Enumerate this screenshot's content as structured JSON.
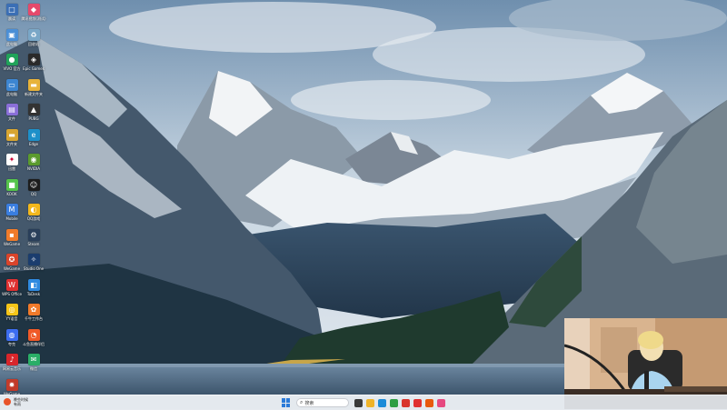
{
  "desktop": {
    "icons": [
      {
        "label": "晨读",
        "icon": "app-icon",
        "color": "#3b6fb5",
        "glyph": "□"
      },
      {
        "label": "腾讯视频(测试)",
        "icon": "app-icon",
        "color": "#e54a6b",
        "glyph": "◆"
      },
      {
        "label": "此电脑",
        "icon": "computer-icon",
        "color": "#4b8fd6",
        "glyph": "▣"
      },
      {
        "label": "回收站",
        "icon": "recycle-bin-icon",
        "color": "#7aa7c7",
        "glyph": "♻"
      },
      {
        "label": "VIVO 官方",
        "icon": "app-icon",
        "color": "#21a35a",
        "glyph": "●"
      },
      {
        "label": "Epic Games",
        "icon": "app-icon",
        "color": "#2a2a2a",
        "glyph": "◈"
      },
      {
        "label": "此电脑",
        "icon": "computer-icon",
        "color": "#3d86d1",
        "glyph": "▭"
      },
      {
        "label": "新建文件夹",
        "icon": "folder-icon",
        "color": "#e8b33a",
        "glyph": "▬"
      },
      {
        "label": "文件",
        "icon": "file-icon",
        "color": "#8a6fd8",
        "glyph": "▤"
      },
      {
        "label": "PUBG",
        "icon": "app-icon",
        "color": "#333333",
        "glyph": "▲"
      },
      {
        "label": "文件夹",
        "icon": "folder-icon",
        "color": "#d8a531",
        "glyph": "▬"
      },
      {
        "label": "Edge",
        "icon": "browser-icon",
        "color": "#1e90c9",
        "glyph": "e"
      },
      {
        "label": "迅雷",
        "icon": "app-icon",
        "color": "#ffffff",
        "glyph": "✦"
      },
      {
        "label": "NVIDIA",
        "icon": "app-icon",
        "color": "#5b9b2e",
        "glyph": "◉"
      },
      {
        "label": "KOOK",
        "icon": "app-icon",
        "color": "#55c44b",
        "glyph": "■"
      },
      {
        "label": "QQ",
        "icon": "qq-icon",
        "color": "#1d1d1d",
        "glyph": "☺"
      },
      {
        "label": "Mobile",
        "icon": "app-icon",
        "color": "#3a7ee0",
        "glyph": "M"
      },
      {
        "label": "QQ游戏",
        "icon": "app-icon",
        "color": "#f2b71c",
        "glyph": "◐"
      },
      {
        "label": "WeGame",
        "icon": "app-icon",
        "color": "#f07b2a",
        "glyph": "▪"
      },
      {
        "label": "Steam",
        "icon": "steam-icon",
        "color": "#2a3f5a",
        "glyph": "⚙"
      },
      {
        "label": "WeGame",
        "icon": "app-icon",
        "color": "#d9442b",
        "glyph": "✪"
      },
      {
        "label": "Studio One",
        "icon": "app-icon",
        "color": "#1b3d6e",
        "glyph": "✧"
      },
      {
        "label": "WPS Office",
        "icon": "app-icon",
        "color": "#e03131",
        "glyph": "W"
      },
      {
        "label": "ToDesk",
        "icon": "app-icon",
        "color": "#2f8ae0",
        "glyph": "◧"
      },
      {
        "label": "YY语音",
        "icon": "app-icon",
        "color": "#f5c518",
        "glyph": "◎"
      },
      {
        "label": "千牛工作台",
        "icon": "app-icon",
        "color": "#f07a2a",
        "glyph": "✿"
      },
      {
        "label": "夸克",
        "icon": "app-icon",
        "color": "#3c6df0",
        "glyph": "◍"
      },
      {
        "label": "斗鱼直播伴侣",
        "icon": "app-icon",
        "color": "#f05a28",
        "glyph": "◔"
      },
      {
        "label": "网易云音乐",
        "icon": "app-icon",
        "color": "#d8262b",
        "glyph": "♪"
      },
      {
        "label": "微信",
        "icon": "wechat-icon",
        "color": "#2aae67",
        "glyph": "✉"
      },
      {
        "label": "WeGame",
        "icon": "app-icon",
        "color": "#c23b2a",
        "glyph": "✹"
      }
    ]
  },
  "taskbar": {
    "weather_line1": "晚些时候",
    "weather_line2": "有雨",
    "search_placeholder": "搜索",
    "apps": [
      {
        "name": "task-view-app",
        "color": "#3a3a3a"
      },
      {
        "name": "explorer-app",
        "color": "#f0b429"
      },
      {
        "name": "edge-app",
        "color": "#1b8bd8"
      },
      {
        "name": "chrome-app",
        "color": "#2f9e44"
      },
      {
        "name": "app-red",
        "color": "#d9342b"
      },
      {
        "name": "wps-app",
        "color": "#e03131"
      },
      {
        "name": "app-orange",
        "color": "#e8590c"
      },
      {
        "name": "app-pink",
        "color": "#e64980"
      }
    ]
  },
  "colors": {
    "sky": "#9bbad3",
    "lake": "#4d6a84",
    "taskbar": "#e4e8ee"
  }
}
